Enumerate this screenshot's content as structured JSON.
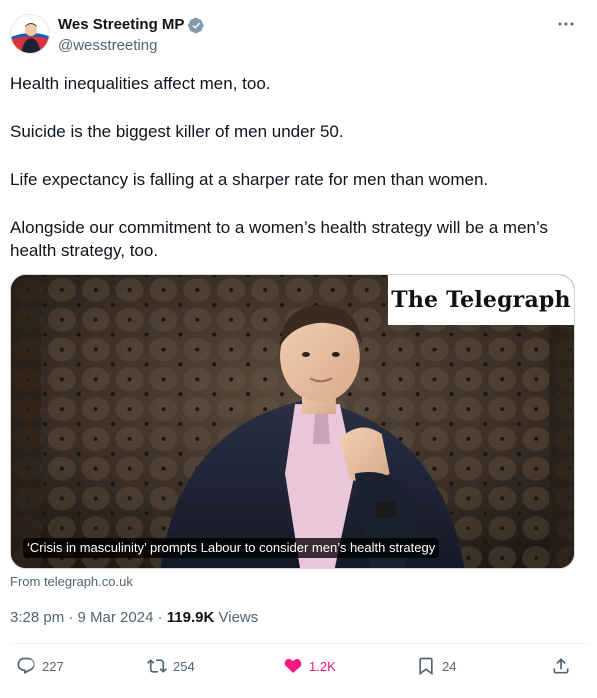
{
  "author": {
    "name": "Wes Streeting MP",
    "handle": "@wesstreeting",
    "verified_icon": "verified-badge-icon"
  },
  "tweet": {
    "paragraphs": [
      "Health inequalities affect men, too.",
      "Suicide is the biggest killer of men under 50.",
      "Life expectancy is falling at a sharper rate for men than women.",
      "Alongside our commitment to a women’s health strategy will be a men’s health strategy, too."
    ]
  },
  "media": {
    "publisher_logo": "The Telegraph",
    "headline": "‘Crisis in masculinity’ prompts Labour to consider men’s health strategy",
    "source": "From telegraph.co.uk"
  },
  "meta": {
    "time": "3:28 pm",
    "separator": "·",
    "date": "9 Mar 2024",
    "views_count": "119.9K",
    "views_label": "Views"
  },
  "actions": {
    "replies": "227",
    "reposts": "254",
    "likes": "1.2K",
    "bookmarks": "24"
  },
  "colors": {
    "text": "#0f1419",
    "secondary": "#536471",
    "like": "#f91880",
    "verified": "#829aab",
    "border": "#cfd9de"
  }
}
